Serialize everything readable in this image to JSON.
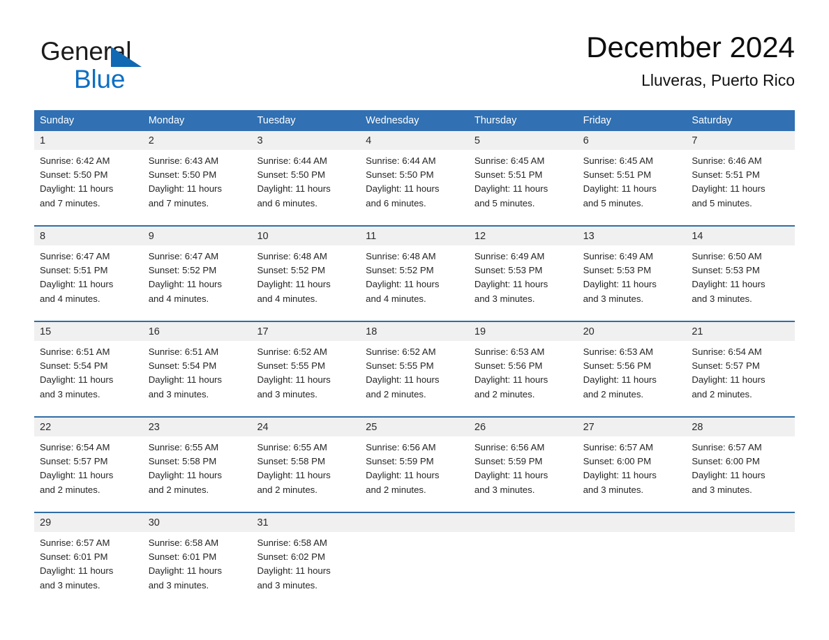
{
  "brand": {
    "name_part1": "General",
    "name_part2": "Blue",
    "triangle_color": "#1168b3",
    "blue_color": "#0c6fc4"
  },
  "header": {
    "title": "December 2024",
    "subtitle": "Lluveras, Puerto Rico"
  },
  "theme": {
    "header_blue": "#3070b3",
    "row_divider_blue": "#2e6da6",
    "daynum_band_gray": "#f0f0f0"
  },
  "calendar": {
    "day_headers": [
      "Sunday",
      "Monday",
      "Tuesday",
      "Wednesday",
      "Thursday",
      "Friday",
      "Saturday"
    ],
    "weeks": [
      {
        "days": [
          {
            "date": "1",
            "sunrise": "Sunrise: 6:42 AM",
            "sunset": "Sunset: 5:50 PM",
            "daylight_1": "Daylight: 11 hours",
            "daylight_2": "and 7 minutes."
          },
          {
            "date": "2",
            "sunrise": "Sunrise: 6:43 AM",
            "sunset": "Sunset: 5:50 PM",
            "daylight_1": "Daylight: 11 hours",
            "daylight_2": "and 7 minutes."
          },
          {
            "date": "3",
            "sunrise": "Sunrise: 6:44 AM",
            "sunset": "Sunset: 5:50 PM",
            "daylight_1": "Daylight: 11 hours",
            "daylight_2": "and 6 minutes."
          },
          {
            "date": "4",
            "sunrise": "Sunrise: 6:44 AM",
            "sunset": "Sunset: 5:50 PM",
            "daylight_1": "Daylight: 11 hours",
            "daylight_2": "and 6 minutes."
          },
          {
            "date": "5",
            "sunrise": "Sunrise: 6:45 AM",
            "sunset": "Sunset: 5:51 PM",
            "daylight_1": "Daylight: 11 hours",
            "daylight_2": "and 5 minutes."
          },
          {
            "date": "6",
            "sunrise": "Sunrise: 6:45 AM",
            "sunset": "Sunset: 5:51 PM",
            "daylight_1": "Daylight: 11 hours",
            "daylight_2": "and 5 minutes."
          },
          {
            "date": "7",
            "sunrise": "Sunrise: 6:46 AM",
            "sunset": "Sunset: 5:51 PM",
            "daylight_1": "Daylight: 11 hours",
            "daylight_2": "and 5 minutes."
          }
        ]
      },
      {
        "days": [
          {
            "date": "8",
            "sunrise": "Sunrise: 6:47 AM",
            "sunset": "Sunset: 5:51 PM",
            "daylight_1": "Daylight: 11 hours",
            "daylight_2": "and 4 minutes."
          },
          {
            "date": "9",
            "sunrise": "Sunrise: 6:47 AM",
            "sunset": "Sunset: 5:52 PM",
            "daylight_1": "Daylight: 11 hours",
            "daylight_2": "and 4 minutes."
          },
          {
            "date": "10",
            "sunrise": "Sunrise: 6:48 AM",
            "sunset": "Sunset: 5:52 PM",
            "daylight_1": "Daylight: 11 hours",
            "daylight_2": "and 4 minutes."
          },
          {
            "date": "11",
            "sunrise": "Sunrise: 6:48 AM",
            "sunset": "Sunset: 5:52 PM",
            "daylight_1": "Daylight: 11 hours",
            "daylight_2": "and 4 minutes."
          },
          {
            "date": "12",
            "sunrise": "Sunrise: 6:49 AM",
            "sunset": "Sunset: 5:53 PM",
            "daylight_1": "Daylight: 11 hours",
            "daylight_2": "and 3 minutes."
          },
          {
            "date": "13",
            "sunrise": "Sunrise: 6:49 AM",
            "sunset": "Sunset: 5:53 PM",
            "daylight_1": "Daylight: 11 hours",
            "daylight_2": "and 3 minutes."
          },
          {
            "date": "14",
            "sunrise": "Sunrise: 6:50 AM",
            "sunset": "Sunset: 5:53 PM",
            "daylight_1": "Daylight: 11 hours",
            "daylight_2": "and 3 minutes."
          }
        ]
      },
      {
        "days": [
          {
            "date": "15",
            "sunrise": "Sunrise: 6:51 AM",
            "sunset": "Sunset: 5:54 PM",
            "daylight_1": "Daylight: 11 hours",
            "daylight_2": "and 3 minutes."
          },
          {
            "date": "16",
            "sunrise": "Sunrise: 6:51 AM",
            "sunset": "Sunset: 5:54 PM",
            "daylight_1": "Daylight: 11 hours",
            "daylight_2": "and 3 minutes."
          },
          {
            "date": "17",
            "sunrise": "Sunrise: 6:52 AM",
            "sunset": "Sunset: 5:55 PM",
            "daylight_1": "Daylight: 11 hours",
            "daylight_2": "and 3 minutes."
          },
          {
            "date": "18",
            "sunrise": "Sunrise: 6:52 AM",
            "sunset": "Sunset: 5:55 PM",
            "daylight_1": "Daylight: 11 hours",
            "daylight_2": "and 2 minutes."
          },
          {
            "date": "19",
            "sunrise": "Sunrise: 6:53 AM",
            "sunset": "Sunset: 5:56 PM",
            "daylight_1": "Daylight: 11 hours",
            "daylight_2": "and 2 minutes."
          },
          {
            "date": "20",
            "sunrise": "Sunrise: 6:53 AM",
            "sunset": "Sunset: 5:56 PM",
            "daylight_1": "Daylight: 11 hours",
            "daylight_2": "and 2 minutes."
          },
          {
            "date": "21",
            "sunrise": "Sunrise: 6:54 AM",
            "sunset": "Sunset: 5:57 PM",
            "daylight_1": "Daylight: 11 hours",
            "daylight_2": "and 2 minutes."
          }
        ]
      },
      {
        "days": [
          {
            "date": "22",
            "sunrise": "Sunrise: 6:54 AM",
            "sunset": "Sunset: 5:57 PM",
            "daylight_1": "Daylight: 11 hours",
            "daylight_2": "and 2 minutes."
          },
          {
            "date": "23",
            "sunrise": "Sunrise: 6:55 AM",
            "sunset": "Sunset: 5:58 PM",
            "daylight_1": "Daylight: 11 hours",
            "daylight_2": "and 2 minutes."
          },
          {
            "date": "24",
            "sunrise": "Sunrise: 6:55 AM",
            "sunset": "Sunset: 5:58 PM",
            "daylight_1": "Daylight: 11 hours",
            "daylight_2": "and 2 minutes."
          },
          {
            "date": "25",
            "sunrise": "Sunrise: 6:56 AM",
            "sunset": "Sunset: 5:59 PM",
            "daylight_1": "Daylight: 11 hours",
            "daylight_2": "and 2 minutes."
          },
          {
            "date": "26",
            "sunrise": "Sunrise: 6:56 AM",
            "sunset": "Sunset: 5:59 PM",
            "daylight_1": "Daylight: 11 hours",
            "daylight_2": "and 3 minutes."
          },
          {
            "date": "27",
            "sunrise": "Sunrise: 6:57 AM",
            "sunset": "Sunset: 6:00 PM",
            "daylight_1": "Daylight: 11 hours",
            "daylight_2": "and 3 minutes."
          },
          {
            "date": "28",
            "sunrise": "Sunrise: 6:57 AM",
            "sunset": "Sunset: 6:00 PM",
            "daylight_1": "Daylight: 11 hours",
            "daylight_2": "and 3 minutes."
          }
        ]
      },
      {
        "days": [
          {
            "date": "29",
            "sunrise": "Sunrise: 6:57 AM",
            "sunset": "Sunset: 6:01 PM",
            "daylight_1": "Daylight: 11 hours",
            "daylight_2": "and 3 minutes."
          },
          {
            "date": "30",
            "sunrise": "Sunrise: 6:58 AM",
            "sunset": "Sunset: 6:01 PM",
            "daylight_1": "Daylight: 11 hours",
            "daylight_2": "and 3 minutes."
          },
          {
            "date": "31",
            "sunrise": "Sunrise: 6:58 AM",
            "sunset": "Sunset: 6:02 PM",
            "daylight_1": "Daylight: 11 hours",
            "daylight_2": "and 3 minutes."
          },
          {
            "date": "",
            "sunrise": "",
            "sunset": "",
            "daylight_1": "",
            "daylight_2": ""
          },
          {
            "date": "",
            "sunrise": "",
            "sunset": "",
            "daylight_1": "",
            "daylight_2": ""
          },
          {
            "date": "",
            "sunrise": "",
            "sunset": "",
            "daylight_1": "",
            "daylight_2": ""
          },
          {
            "date": "",
            "sunrise": "",
            "sunset": "",
            "daylight_1": "",
            "daylight_2": ""
          }
        ]
      }
    ]
  }
}
